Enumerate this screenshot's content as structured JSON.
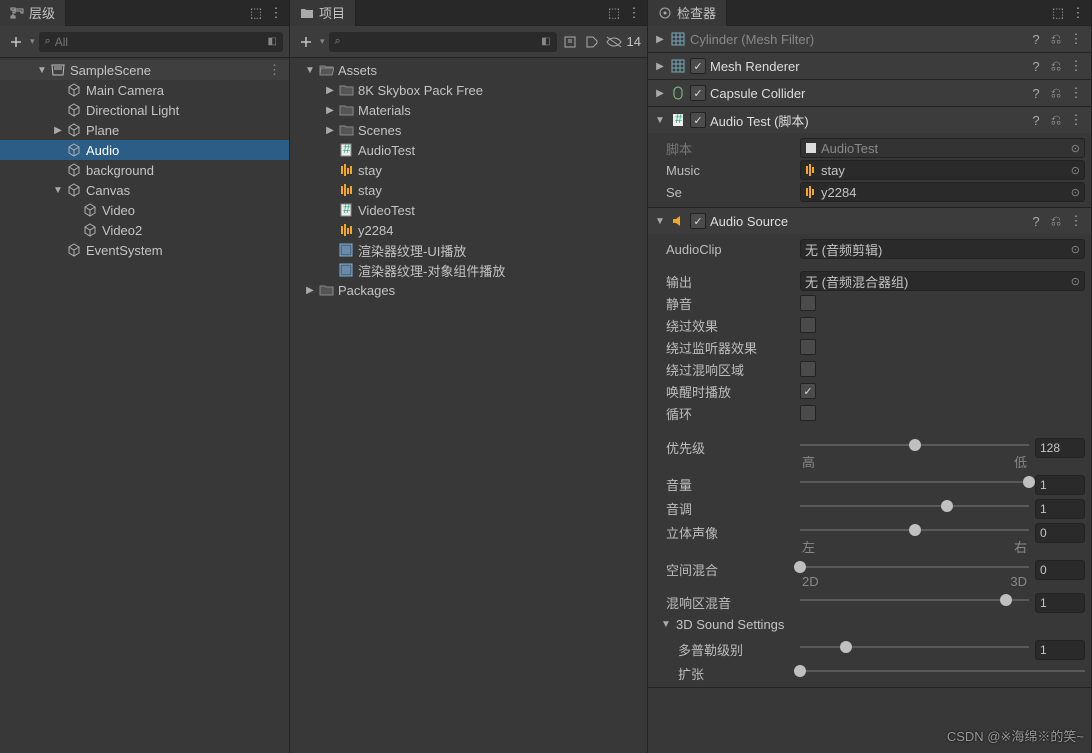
{
  "hierarchy": {
    "title": "层级",
    "search_placeholder": "All",
    "items": [
      {
        "label": "SampleScene",
        "indent": 0,
        "arrow": "down",
        "icon": "scene",
        "header": true,
        "menu": true
      },
      {
        "label": "Main Camera",
        "indent": 1,
        "icon": "cube"
      },
      {
        "label": "Directional Light",
        "indent": 1,
        "icon": "cube"
      },
      {
        "label": "Plane",
        "indent": 1,
        "arrow": "right",
        "icon": "cube"
      },
      {
        "label": "Audio",
        "indent": 1,
        "icon": "cube",
        "selected": true
      },
      {
        "label": "background",
        "indent": 1,
        "icon": "cube"
      },
      {
        "label": "Canvas",
        "indent": 1,
        "arrow": "down",
        "icon": "cube"
      },
      {
        "label": "Video",
        "indent": 2,
        "icon": "cube"
      },
      {
        "label": "Video2",
        "indent": 2,
        "icon": "cube"
      },
      {
        "label": "EventSystem",
        "indent": 1,
        "icon": "cube"
      }
    ]
  },
  "project": {
    "title": "项目",
    "hidden_count": "14",
    "items": [
      {
        "label": "Assets",
        "indent": 0,
        "arrow": "down",
        "icon": "folder-open"
      },
      {
        "label": "8K Skybox Pack Free",
        "indent": 1,
        "arrow": "right",
        "icon": "folder"
      },
      {
        "label": "Materials",
        "indent": 1,
        "arrow": "right",
        "icon": "folder"
      },
      {
        "label": "Scenes",
        "indent": 1,
        "arrow": "right",
        "icon": "folder"
      },
      {
        "label": "AudioTest",
        "indent": 1,
        "icon": "script"
      },
      {
        "label": "stay",
        "indent": 1,
        "icon": "audio"
      },
      {
        "label": "stay",
        "indent": 1,
        "icon": "audio"
      },
      {
        "label": "VideoTest",
        "indent": 1,
        "icon": "script"
      },
      {
        "label": "y2284",
        "indent": 1,
        "icon": "audio"
      },
      {
        "label": "渲染器纹理-UI播放",
        "indent": 1,
        "icon": "render"
      },
      {
        "label": "渲染器纹理-对象组件播放",
        "indent": 1,
        "icon": "render"
      },
      {
        "label": "Packages",
        "indent": 0,
        "arrow": "right",
        "icon": "folder"
      }
    ]
  },
  "inspector": {
    "title": "检查器",
    "components": [
      {
        "name": "Cylinder (Mesh Filter)",
        "checkbox": false,
        "icon": "mesh",
        "arrow": "right",
        "dim": true
      },
      {
        "name": "Mesh Renderer",
        "checkbox": true,
        "icon": "mesh",
        "arrow": "right"
      },
      {
        "name": "Capsule Collider",
        "checkbox": true,
        "icon": "collider",
        "arrow": "right"
      },
      {
        "name": "Audio Test   (脚本)",
        "checkbox": true,
        "icon": "script",
        "arrow": "down",
        "open": true,
        "props": [
          {
            "label": "脚本",
            "type": "objfield",
            "value": "AudioTest",
            "dim": true,
            "icon": "script-small"
          },
          {
            "label": "Music",
            "type": "objfield",
            "value": "stay",
            "icon": "audio-small"
          },
          {
            "label": "Se",
            "type": "objfield",
            "value": "y2284",
            "icon": "audio-small"
          }
        ]
      },
      {
        "name": "Audio Source",
        "checkbox": true,
        "icon": "audio",
        "arrow": "down",
        "open": true,
        "body": "audio_source"
      }
    ],
    "audio_source": {
      "audioclip_label": "AudioClip",
      "audioclip_value": "无 (音频剪辑)",
      "output_label": "输出",
      "output_value": "无 (音频混合器组)",
      "mute": "静音",
      "bypass_effects": "绕过效果",
      "bypass_listener": "绕过监听器效果",
      "bypass_reverb": "绕过混响区域",
      "play_on_awake": "唤醒时播放",
      "loop": "循环",
      "priority": {
        "label": "优先级",
        "value": "128",
        "pos": 50,
        "left": "高",
        "right": "低"
      },
      "volume": {
        "label": "音量",
        "value": "1",
        "pos": 100
      },
      "pitch": {
        "label": "音调",
        "value": "1",
        "pos": 64
      },
      "stereo": {
        "label": "立体声像",
        "value": "0",
        "pos": 50,
        "left": "左",
        "right": "右"
      },
      "spatial": {
        "label": "空间混合",
        "value": "0",
        "pos": 0,
        "left": "2D",
        "right": "3D"
      },
      "reverb": {
        "label": "混响区混音",
        "value": "1",
        "pos": 90
      },
      "section_3d": "3D Sound Settings",
      "doppler": {
        "label": "多普勒级别",
        "value": "1",
        "pos": 20
      },
      "spread": {
        "label": "扩张",
        "pos": 0
      }
    }
  },
  "watermark": "CSDN @※海绵※的笑~"
}
